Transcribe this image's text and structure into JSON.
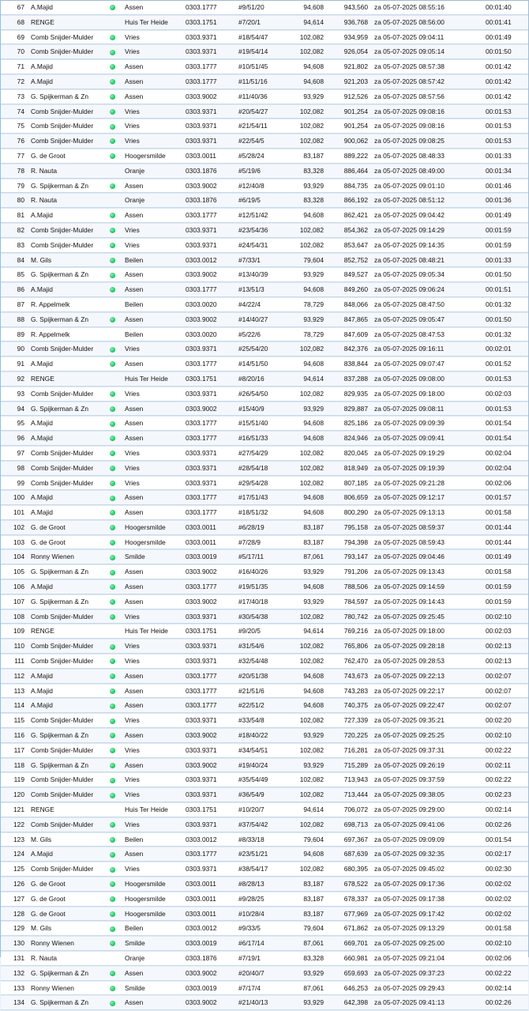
{
  "colors": {
    "dot": "#2fc76e",
    "row_border": "#c9d9ea",
    "frame": "#9fbad4"
  },
  "rows": [
    [
      "67",
      "A.Majid",
      1,
      "Assen",
      "0303.1777",
      "#9/51/20",
      "94,608",
      "943,560",
      "za 05-07-2025 08:55:16",
      "00:01:40"
    ],
    [
      "68",
      "RENGE",
      0,
      "Huis Ter Heide",
      "0303.1751",
      "#7/20/1",
      "94,614",
      "936,768",
      "za 05-07-2025 08:56:00",
      "00:01:41"
    ],
    [
      "69",
      "Comb Snijder-Mulder",
      1,
      "Vries",
      "0303.9371",
      "#18/54/47",
      "102,082",
      "934,959",
      "za 05-07-2025 09:04:11",
      "00:01:49"
    ],
    [
      "70",
      "Comb Snijder-Mulder",
      1,
      "Vries",
      "0303.9371",
      "#19/54/14",
      "102,082",
      "926,054",
      "za 05-07-2025 09:05:14",
      "00:01:50"
    ],
    [
      "71",
      "A.Majid",
      1,
      "Assen",
      "0303.1777",
      "#10/51/45",
      "94,608",
      "921,802",
      "za 05-07-2025 08:57:38",
      "00:01:42"
    ],
    [
      "72",
      "A.Majid",
      1,
      "Assen",
      "0303.1777",
      "#11/51/16",
      "94,608",
      "921,203",
      "za 05-07-2025 08:57:42",
      "00:01:42"
    ],
    [
      "73",
      "G. Spijkerman & Zn",
      1,
      "Assen",
      "0303.9002",
      "#11/40/36",
      "93,929",
      "912,526",
      "za 05-07-2025 08:57:56",
      "00:01:42"
    ],
    [
      "74",
      "Comb Snijder-Mulder",
      1,
      "Vries",
      "0303.9371",
      "#20/54/27",
      "102,082",
      "901,254",
      "za 05-07-2025 09:08:16",
      "00:01:53"
    ],
    [
      "75",
      "Comb Snijder-Mulder",
      1,
      "Vries",
      "0303.9371",
      "#21/54/11",
      "102,082",
      "901,254",
      "za 05-07-2025 09:08:16",
      "00:01:53"
    ],
    [
      "76",
      "Comb Snijder-Mulder",
      1,
      "Vries",
      "0303.9371",
      "#22/54/5",
      "102,082",
      "900,062",
      "za 05-07-2025 09:08:25",
      "00:01:53"
    ],
    [
      "77",
      "G. de Groot",
      1,
      "Hoogersmilde",
      "0303.0011",
      "#5/28/24",
      "83,187",
      "889,222",
      "za 05-07-2025 08:48:33",
      "00:01:33"
    ],
    [
      "78",
      "R. Nauta",
      0,
      "Oranje",
      "0303.1876",
      "#5/19/6",
      "83,328",
      "886,464",
      "za 05-07-2025 08:49:00",
      "00:01:34"
    ],
    [
      "79",
      "G. Spijkerman & Zn",
      1,
      "Assen",
      "0303.9002",
      "#12/40/8",
      "93,929",
      "884,735",
      "za 05-07-2025 09:01:10",
      "00:01:46"
    ],
    [
      "80",
      "R. Nauta",
      0,
      "Oranje",
      "0303.1876",
      "#6/19/5",
      "83,328",
      "866,192",
      "za 05-07-2025 08:51:12",
      "00:01:36"
    ],
    [
      "81",
      "A.Majid",
      1,
      "Assen",
      "0303.1777",
      "#12/51/42",
      "94,608",
      "862,421",
      "za 05-07-2025 09:04:42",
      "00:01:49"
    ],
    [
      "82",
      "Comb Snijder-Mulder",
      1,
      "Vries",
      "0303.9371",
      "#23/54/36",
      "102,082",
      "854,362",
      "za 05-07-2025 09:14:29",
      "00:01:59"
    ],
    [
      "83",
      "Comb Snijder-Mulder",
      1,
      "Vries",
      "0303.9371",
      "#24/54/31",
      "102,082",
      "853,647",
      "za 05-07-2025 09:14:35",
      "00:01:59"
    ],
    [
      "84",
      "M. Gils",
      1,
      "Beilen",
      "0303.0012",
      "#7/33/1",
      "79,604",
      "852,752",
      "za 05-07-2025 08:48:21",
      "00:01:33"
    ],
    [
      "85",
      "G. Spijkerman & Zn",
      1,
      "Assen",
      "0303.9002",
      "#13/40/39",
      "93,929",
      "849,527",
      "za 05-07-2025 09:05:34",
      "00:01:50"
    ],
    [
      "86",
      "A.Majid",
      1,
      "Assen",
      "0303.1777",
      "#13/51/3",
      "94,608",
      "849,260",
      "za 05-07-2025 09:06:24",
      "00:01:51"
    ],
    [
      "87",
      "R. Appelmelk",
      0,
      "Beilen",
      "0303.0020",
      "#4/22/4",
      "78,729",
      "848,066",
      "za 05-07-2025 08:47:50",
      "00:01:32"
    ],
    [
      "88",
      "G. Spijkerman & Zn",
      1,
      "Assen",
      "0303.9002",
      "#14/40/27",
      "93,929",
      "847,865",
      "za 05-07-2025 09:05:47",
      "00:01:50"
    ],
    [
      "89",
      "R. Appelmelk",
      0,
      "Beilen",
      "0303.0020",
      "#5/22/6",
      "78,729",
      "847,609",
      "za 05-07-2025 08:47:53",
      "00:01:32"
    ],
    [
      "90",
      "Comb Snijder-Mulder",
      1,
      "Vries",
      "0303.9371",
      "#25/54/20",
      "102,082",
      "842,376",
      "za 05-07-2025 09:16:11",
      "00:02:01"
    ],
    [
      "91",
      "A.Majid",
      1,
      "Assen",
      "0303.1777",
      "#14/51/50",
      "94,608",
      "838,844",
      "za 05-07-2025 09:07:47",
      "00:01:52"
    ],
    [
      "92",
      "RENGE",
      0,
      "Huis Ter Heide",
      "0303.1751",
      "#8/20/16",
      "94,614",
      "837,288",
      "za 05-07-2025 09:08:00",
      "00:01:53"
    ],
    [
      "93",
      "Comb Snijder-Mulder",
      1,
      "Vries",
      "0303.9371",
      "#26/54/50",
      "102,082",
      "829,935",
      "za 05-07-2025 09:18:00",
      "00:02:03"
    ],
    [
      "94",
      "G. Spijkerman & Zn",
      1,
      "Assen",
      "0303.9002",
      "#15/40/9",
      "93,929",
      "829,887",
      "za 05-07-2025 09:08:11",
      "00:01:53"
    ],
    [
      "95",
      "A.Majid",
      1,
      "Assen",
      "0303.1777",
      "#15/51/40",
      "94,608",
      "825,186",
      "za 05-07-2025 09:09:39",
      "00:01:54"
    ],
    [
      "96",
      "A.Majid",
      1,
      "Assen",
      "0303.1777",
      "#16/51/33",
      "94,608",
      "824,946",
      "za 05-07-2025 09:09:41",
      "00:01:54"
    ],
    [
      "97",
      "Comb Snijder-Mulder",
      1,
      "Vries",
      "0303.9371",
      "#27/54/29",
      "102,082",
      "820,045",
      "za 05-07-2025 09:19:29",
      "00:02:04"
    ],
    [
      "98",
      "Comb Snijder-Mulder",
      1,
      "Vries",
      "0303.9371",
      "#28/54/18",
      "102,082",
      "818,949",
      "za 05-07-2025 09:19:39",
      "00:02:04"
    ],
    [
      "99",
      "Comb Snijder-Mulder",
      1,
      "Vries",
      "0303.9371",
      "#29/54/28",
      "102,082",
      "807,185",
      "za 05-07-2025 09:21:28",
      "00:02:06"
    ],
    [
      "100",
      "A.Majid",
      1,
      "Assen",
      "0303.1777",
      "#17/51/43",
      "94,608",
      "806,659",
      "za 05-07-2025 09:12:17",
      "00:01:57"
    ],
    [
      "101",
      "A.Majid",
      1,
      "Assen",
      "0303.1777",
      "#18/51/32",
      "94,608",
      "800,290",
      "za 05-07-2025 09:13:13",
      "00:01:58"
    ],
    [
      "102",
      "G. de Groot",
      1,
      "Hoogersmilde",
      "0303.0011",
      "#6/28/19",
      "83,187",
      "795,158",
      "za 05-07-2025 08:59:37",
      "00:01:44"
    ],
    [
      "103",
      "G. de Groot",
      1,
      "Hoogersmilde",
      "0303.0011",
      "#7/28/9",
      "83,187",
      "794,398",
      "za 05-07-2025 08:59:43",
      "00:01:44"
    ],
    [
      "104",
      "Ronny Wienen",
      1,
      "Smilde",
      "0303.0019",
      "#5/17/11",
      "87,061",
      "793,147",
      "za 05-07-2025 09:04:46",
      "00:01:49"
    ],
    [
      "105",
      "G. Spijkerman & Zn",
      1,
      "Assen",
      "0303.9002",
      "#16/40/26",
      "93,929",
      "791,206",
      "za 05-07-2025 09:13:43",
      "00:01:58"
    ],
    [
      "106",
      "A.Majid",
      1,
      "Assen",
      "0303.1777",
      "#19/51/35",
      "94,608",
      "788,506",
      "za 05-07-2025 09:14:59",
      "00:01:59"
    ],
    [
      "107",
      "G. Spijkerman & Zn",
      1,
      "Assen",
      "0303.9002",
      "#17/40/18",
      "93,929",
      "784,597",
      "za 05-07-2025 09:14:43",
      "00:01:59"
    ],
    [
      "108",
      "Comb Snijder-Mulder",
      1,
      "Vries",
      "0303.9371",
      "#30/54/38",
      "102,082",
      "780,742",
      "za 05-07-2025 09:25:45",
      "00:02:10"
    ],
    [
      "109",
      "RENGE",
      0,
      "Huis Ter Heide",
      "0303.1751",
      "#9/20/5",
      "94,614",
      "769,216",
      "za 05-07-2025 09:18:00",
      "00:02:03"
    ],
    [
      "110",
      "Comb Snijder-Mulder",
      1,
      "Vries",
      "0303.9371",
      "#31/54/6",
      "102,082",
      "765,806",
      "za 05-07-2025 09:28:18",
      "00:02:13"
    ],
    [
      "111",
      "Comb Snijder-Mulder",
      1,
      "Vries",
      "0303.9371",
      "#32/54/48",
      "102,082",
      "762,470",
      "za 05-07-2025 09:28:53",
      "00:02:13"
    ],
    [
      "112",
      "A.Majid",
      1,
      "Assen",
      "0303.1777",
      "#20/51/38",
      "94,608",
      "743,673",
      "za 05-07-2025 09:22:13",
      "00:02:07"
    ],
    [
      "113",
      "A.Majid",
      1,
      "Assen",
      "0303.1777",
      "#21/51/6",
      "94,608",
      "743,283",
      "za 05-07-2025 09:22:17",
      "00:02:07"
    ],
    [
      "114",
      "A.Majid",
      1,
      "Assen",
      "0303.1777",
      "#22/51/2",
      "94,608",
      "740,375",
      "za 05-07-2025 09:22:47",
      "00:02:07"
    ],
    [
      "115",
      "Comb Snijder-Mulder",
      1,
      "Vries",
      "0303.9371",
      "#33/54/8",
      "102,082",
      "727,339",
      "za 05-07-2025 09:35:21",
      "00:02:20"
    ],
    [
      "116",
      "G. Spijkerman & Zn",
      1,
      "Assen",
      "0303.9002",
      "#18/40/22",
      "93,929",
      "720,225",
      "za 05-07-2025 09:25:25",
      "00:02:10"
    ],
    [
      "117",
      "Comb Snijder-Mulder",
      1,
      "Vries",
      "0303.9371",
      "#34/54/51",
      "102,082",
      "716,281",
      "za 05-07-2025 09:37:31",
      "00:02:22"
    ],
    [
      "118",
      "G. Spijkerman & Zn",
      1,
      "Assen",
      "0303.9002",
      "#19/40/24",
      "93,929",
      "715,289",
      "za 05-07-2025 09:26:19",
      "00:02:11"
    ],
    [
      "119",
      "Comb Snijder-Mulder",
      1,
      "Vries",
      "0303.9371",
      "#35/54/49",
      "102,082",
      "713,943",
      "za 05-07-2025 09:37:59",
      "00:02:22"
    ],
    [
      "120",
      "Comb Snijder-Mulder",
      1,
      "Vries",
      "0303.9371",
      "#36/54/9",
      "102,082",
      "713,444",
      "za 05-07-2025 09:38:05",
      "00:02:23"
    ],
    [
      "121",
      "RENGE",
      0,
      "Huis Ter Heide",
      "0303.1751",
      "#10/20/7",
      "94,614",
      "706,072",
      "za 05-07-2025 09:29:00",
      "00:02:14"
    ],
    [
      "122",
      "Comb Snijder-Mulder",
      1,
      "Vries",
      "0303.9371",
      "#37/54/42",
      "102,082",
      "698,713",
      "za 05-07-2025 09:41:06",
      "00:02:26"
    ],
    [
      "123",
      "M. Gils",
      1,
      "Beilen",
      "0303.0012",
      "#8/33/18",
      "79,604",
      "697,367",
      "za 05-07-2025 09:09:09",
      "00:01:54"
    ],
    [
      "124",
      "A.Majid",
      1,
      "Assen",
      "0303.1777",
      "#23/51/21",
      "94,608",
      "687,639",
      "za 05-07-2025 09:32:35",
      "00:02:17"
    ],
    [
      "125",
      "Comb Snijder-Mulder",
      1,
      "Vries",
      "0303.9371",
      "#38/54/17",
      "102,082",
      "680,395",
      "za 05-07-2025 09:45:02",
      "00:02:30"
    ],
    [
      "126",
      "G. de Groot",
      1,
      "Hoogersmilde",
      "0303.0011",
      "#8/28/13",
      "83,187",
      "678,522",
      "za 05-07-2025 09:17:36",
      "00:02:02"
    ],
    [
      "127",
      "G. de Groot",
      1,
      "Hoogersmilde",
      "0303.0011",
      "#9/28/25",
      "83,187",
      "678,337",
      "za 05-07-2025 09:17:38",
      "00:02:02"
    ],
    [
      "128",
      "G. de Groot",
      1,
      "Hoogersmilde",
      "0303.0011",
      "#10/28/4",
      "83,187",
      "677,969",
      "za 05-07-2025 09:17:42",
      "00:02:02"
    ],
    [
      "129",
      "M. Gils",
      1,
      "Beilen",
      "0303.0012",
      "#9/33/5",
      "79,604",
      "671,862",
      "za 05-07-2025 09:13:29",
      "00:01:58"
    ],
    [
      "130",
      "Ronny Wienen",
      1,
      "Smilde",
      "0303.0019",
      "#6/17/14",
      "87,061",
      "669,701",
      "za 05-07-2025 09:25:00",
      "00:02:10"
    ],
    [
      "131",
      "R. Nauta",
      0,
      "Oranje",
      "0303.1876",
      "#7/19/1",
      "83,328",
      "660,981",
      "za 05-07-2025 09:21:04",
      "00:02:06"
    ],
    [
      "132",
      "G. Spijkerman & Zn",
      1,
      "Assen",
      "0303.9002",
      "#20/40/7",
      "93,929",
      "659,693",
      "za 05-07-2025 09:37:23",
      "00:02:22"
    ],
    [
      "133",
      "Ronny Wienen",
      1,
      "Smilde",
      "0303.0019",
      "#7/17/4",
      "87,061",
      "646,253",
      "za 05-07-2025 09:29:43",
      "00:02:14"
    ],
    [
      "134",
      "G. Spijkerman & Zn",
      1,
      "Assen",
      "0303.9002",
      "#21/40/13",
      "93,929",
      "642,398",
      "za 05-07-2025 09:41:13",
      "00:02:26"
    ]
  ]
}
